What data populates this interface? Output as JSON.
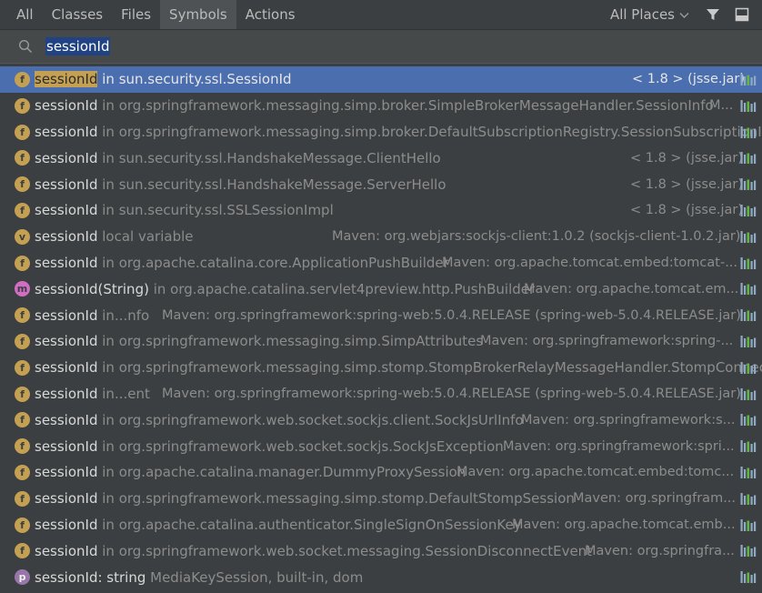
{
  "tabs": [
    {
      "label": "All",
      "active": false
    },
    {
      "label": "Classes",
      "active": false
    },
    {
      "label": "Files",
      "active": false
    },
    {
      "label": "Symbols",
      "active": true
    },
    {
      "label": "Actions",
      "active": false
    }
  ],
  "scope": {
    "label": "All Places"
  },
  "search": {
    "value": "sessionId",
    "icon": "search-icon"
  },
  "colors": {
    "selection": "#4b6eaf",
    "field_icon": "#c4a053",
    "method_icon": "#d16ec4",
    "property_icon": "#9876aa"
  },
  "results": [
    {
      "kind": "f",
      "name": "sessionId",
      "location": "in sun.security.ssl.SessionId",
      "right": "< 1.8 > (jsse.jar)",
      "selected": true
    },
    {
      "kind": "f",
      "name": "sessionId",
      "location": "in org.springframework.messaging.simp.broker.SimpleBrokerMessageHandler.SessionInfo",
      "right": "M..."
    },
    {
      "kind": "f",
      "name": "sessionId",
      "location": "in org.springframework.messaging.simp.broker.DefaultSubscriptionRegistry.SessionSubscriptionInfo",
      "right": ""
    },
    {
      "kind": "f",
      "name": "sessionId",
      "location": "in sun.security.ssl.HandshakeMessage.ClientHello",
      "right": "< 1.8 > (jsse.jar)"
    },
    {
      "kind": "f",
      "name": "sessionId",
      "location": "in sun.security.ssl.HandshakeMessage.ServerHello",
      "right": "< 1.8 > (jsse.jar)"
    },
    {
      "kind": "f",
      "name": "sessionId",
      "location": "in sun.security.ssl.SSLSessionImpl",
      "right": "< 1.8 > (jsse.jar)"
    },
    {
      "kind": "v",
      "name": "sessionId",
      "location": "local variable",
      "right": "Maven: org.webjars:sockjs-client:1.0.2 (sockjs-client-1.0.2.jar)"
    },
    {
      "kind": "f",
      "name": "sessionId",
      "location": "in org.apache.catalina.core.ApplicationPushBuilder",
      "right": "Maven: org.apache.tomcat.embed:tomcat-..."
    },
    {
      "kind": "m",
      "name": "sessionId(String)",
      "location": "in org.apache.catalina.servlet4preview.http.PushBuilder",
      "right": "Maven: org.apache.tomcat.em..."
    },
    {
      "kind": "f",
      "name": "sessionId",
      "location": "in...nfo",
      "right": "Maven: org.springframework:spring-web:5.0.4.RELEASE (spring-web-5.0.4.RELEASE.jar)"
    },
    {
      "kind": "f",
      "name": "sessionId",
      "location": "in org.springframework.messaging.simp.SimpAttributes",
      "right": "Maven: org.springframework:spring-..."
    },
    {
      "kind": "f",
      "name": "sessionId",
      "location": "in org.springframework.messaging.simp.stomp.StompBrokerRelayMessageHandler.StompConnectio",
      "right": ""
    },
    {
      "kind": "f",
      "name": "sessionId",
      "location": "in...ent",
      "right": "Maven: org.springframework:spring-web:5.0.4.RELEASE (spring-web-5.0.4.RELEASE.jar)"
    },
    {
      "kind": "f",
      "name": "sessionId",
      "location": "in org.springframework.web.socket.sockjs.client.SockJsUrlInfo",
      "right": "Maven: org.springframework:s..."
    },
    {
      "kind": "f",
      "name": "sessionId",
      "location": "in org.springframework.web.socket.sockjs.SockJsException",
      "right": "Maven: org.springframework:spri..."
    },
    {
      "kind": "f",
      "name": "sessionId",
      "location": "in org.apache.catalina.manager.DummyProxySession",
      "right": "Maven: org.apache.tomcat.embed:tomc..."
    },
    {
      "kind": "f",
      "name": "sessionId",
      "location": "in org.springframework.messaging.simp.stomp.DefaultStompSession",
      "right": "Maven: org.springfram..."
    },
    {
      "kind": "f",
      "name": "sessionId",
      "location": "in org.apache.catalina.authenticator.SingleSignOnSessionKey",
      "right": "Maven: org.apache.tomcat.emb..."
    },
    {
      "kind": "f",
      "name": "sessionId",
      "location": "in org.springframework.web.socket.messaging.SessionDisconnectEvent",
      "right": "Maven: org.springfra..."
    },
    {
      "kind": "p",
      "name": "sessionId: string",
      "location": "MediaKeySession, built-in, dom",
      "right": ""
    }
  ]
}
